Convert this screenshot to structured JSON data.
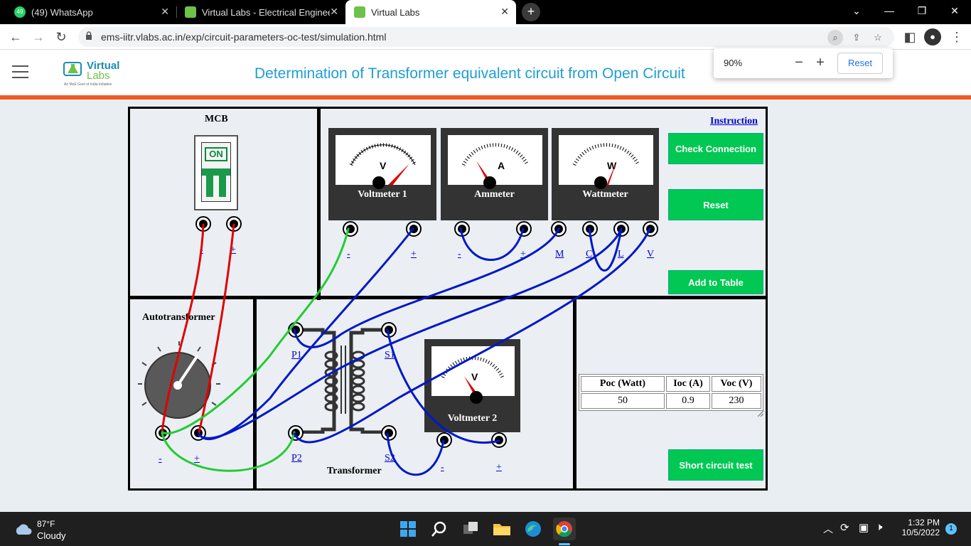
{
  "browser": {
    "tabs": [
      {
        "title": "(49) WhatsApp",
        "badge": "49"
      },
      {
        "title": "Virtual Labs - Electrical Engineerin"
      },
      {
        "title": "Virtual Labs"
      }
    ],
    "url": "ems-iitr.vlabs.ac.in/exp/circuit-parameters-oc-test/simulation.html",
    "zoom": {
      "level": "90%",
      "reset_label": "Reset"
    }
  },
  "header": {
    "logo_top": "Virtual",
    "logo_bottom": "Labs",
    "logo_tagline": "An MoE Govt of India Initiative",
    "title": "Determination of Transformer equivalent circuit from Open Circuit"
  },
  "sim": {
    "mcb": {
      "title": "MCB",
      "on_label": "ON",
      "term_minus": "-",
      "term_plus": "+"
    },
    "meters": [
      {
        "name": "Voltmeter 1",
        "symbol": "V",
        "t1": "-",
        "t2": "+"
      },
      {
        "name": "Ammeter",
        "symbol": "A",
        "t1": "-",
        "t2": "+"
      },
      {
        "name": "Wattmeter",
        "symbol": "W",
        "t1": "M",
        "t2": "C",
        "t3": "L",
        "t4": "V"
      },
      {
        "name": "Voltmeter 2",
        "symbol": "V",
        "t1": "-",
        "t2": "+"
      }
    ],
    "instruction_link": "Instruction",
    "buttons": {
      "check": "Check Connection",
      "reset": "Reset",
      "add": "Add to Table",
      "short": "Short circuit test"
    },
    "autotransformer": {
      "title": "Autotransformer",
      "term_minus": "-",
      "term_plus": "+"
    },
    "transformer": {
      "title": "Transformer",
      "p1": "P1",
      "p2": "P2",
      "s1": "S1",
      "s2": "S2"
    },
    "table": {
      "headers": [
        "Poc (Watt)",
        "Ioc (A)",
        "Voc (V)"
      ],
      "rows": [
        [
          "50",
          "0.9",
          "230"
        ]
      ]
    }
  },
  "taskbar": {
    "temp": "87°F",
    "condition": "Cloudy",
    "time": "1:32 PM",
    "date": "10/5/2022",
    "notif": "1"
  },
  "colors": {
    "accent_green": "#00c853",
    "wire_red": "#e00000",
    "wire_blue": "#0018c8",
    "wire_green": "#22cc33",
    "title_blue": "#1e9ed3",
    "orange": "#f15a24"
  }
}
